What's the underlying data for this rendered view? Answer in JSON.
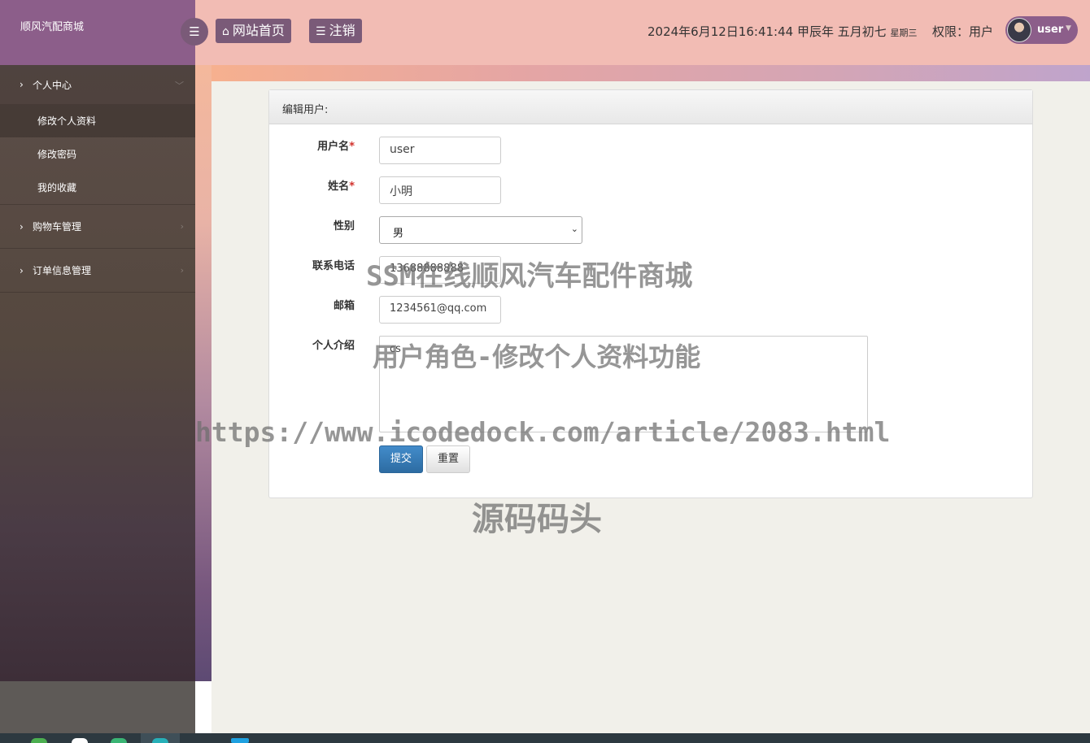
{
  "app": {
    "brand": "顺风汽配商城"
  },
  "sidebar": {
    "groups": [
      {
        "label": "个人中心",
        "items": [
          {
            "label": "修改个人资料"
          },
          {
            "label": "修改密码"
          },
          {
            "label": "我的收藏"
          }
        ]
      },
      {
        "label": "购物车管理"
      },
      {
        "label": "订单信息管理"
      }
    ]
  },
  "header": {
    "home_label": "网站首页",
    "logout_label": "注销",
    "datetime": "2024年6月12日16:41:44 甲辰年 五月初七",
    "weekday": "星期三",
    "permission": "权限：用户",
    "user": "user"
  },
  "form": {
    "title": "编辑用户:",
    "username": {
      "label": "用户名",
      "value": "user"
    },
    "realname": {
      "label": "姓名",
      "value": "小明"
    },
    "gender": {
      "label": "性别",
      "value": "男"
    },
    "phone": {
      "label": "联系电话",
      "value": "13688888888"
    },
    "email": {
      "label": "邮箱",
      "value": "1234561@qq.com"
    },
    "intro": {
      "label": "个人介绍",
      "value": "cs"
    },
    "submit_label": "提交",
    "reset_label": "重置"
  },
  "watermarks": [
    "SSM在线顺风汽车配件商城",
    "用户角色-修改个人资料功能",
    "https://www.icodedock.com/article/2083.html",
    "源码码头"
  ],
  "colors": {
    "sidebar_brand": "#8c5e8a",
    "header": "#f2bcb4",
    "primary_button": "#428bca"
  }
}
